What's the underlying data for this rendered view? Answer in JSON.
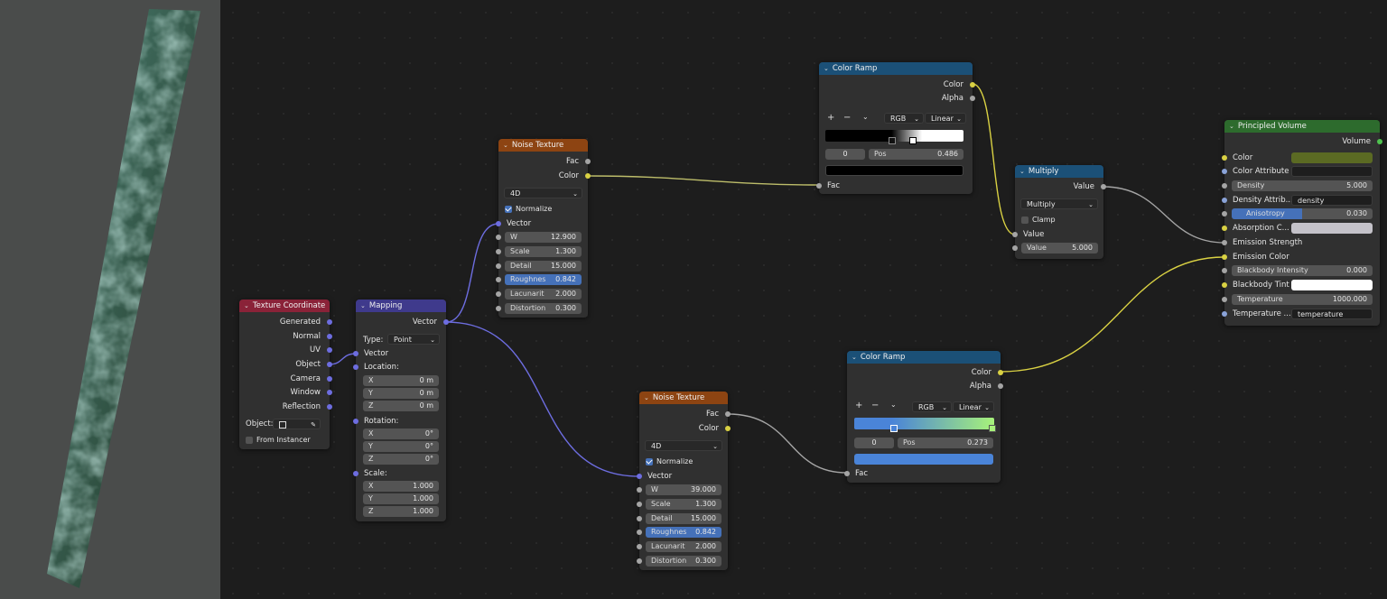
{
  "nodes": {
    "texture_coordinate": {
      "title": "Texture Coordinate",
      "outputs": [
        "Generated",
        "Normal",
        "UV",
        "Object",
        "Camera",
        "Window",
        "Reflection"
      ],
      "object_label": "Object:",
      "from_instancer": "From Instancer"
    },
    "mapping": {
      "title": "Mapping",
      "output": "Vector",
      "type_label": "Type:",
      "type_value": "Point",
      "input_vector": "Vector",
      "location_label": "Location:",
      "location": [
        {
          "axis": "X",
          "value": "0 m"
        },
        {
          "axis": "Y",
          "value": "0 m"
        },
        {
          "axis": "Z",
          "value": "0 m"
        }
      ],
      "rotation_label": "Rotation:",
      "rotation": [
        {
          "axis": "X",
          "value": "0°"
        },
        {
          "axis": "Y",
          "value": "0°"
        },
        {
          "axis": "Z",
          "value": "0°"
        }
      ],
      "scale_label": "Scale:",
      "scale": [
        {
          "axis": "X",
          "value": "1.000"
        },
        {
          "axis": "Y",
          "value": "1.000"
        },
        {
          "axis": "Z",
          "value": "1.000"
        }
      ]
    },
    "noise_texture_1": {
      "title": "Noise Texture",
      "out_fac": "Fac",
      "out_color": "Color",
      "dimensions": "4D",
      "normalize": "Normalize",
      "input_vector": "Vector",
      "fields": [
        {
          "label": "W",
          "value": "12.900"
        },
        {
          "label": "Scale",
          "value": "1.300"
        },
        {
          "label": "Detail",
          "value": "15.000"
        },
        {
          "label": "Roughnes",
          "value": "0.842"
        },
        {
          "label": "Lacunarit",
          "value": "2.000"
        },
        {
          "label": "Distortion",
          "value": "0.300"
        }
      ]
    },
    "noise_texture_2": {
      "title": "Noise Texture",
      "out_fac": "Fac",
      "out_color": "Color",
      "dimensions": "4D",
      "normalize": "Normalize",
      "input_vector": "Vector",
      "fields": [
        {
          "label": "W",
          "value": "39.000"
        },
        {
          "label": "Scale",
          "value": "1.300"
        },
        {
          "label": "Detail",
          "value": "15.000"
        },
        {
          "label": "Roughnes",
          "value": "0.842"
        },
        {
          "label": "Lacunarit",
          "value": "2.000"
        },
        {
          "label": "Distortion",
          "value": "0.300"
        }
      ]
    },
    "color_ramp_1": {
      "title": "Color Ramp",
      "out_color": "Color",
      "out_alpha": "Alpha",
      "mode": "RGB",
      "interpolation": "Linear",
      "index": "0",
      "pos_label": "Pos",
      "pos_value": "0.486",
      "input_fac": "Fac"
    },
    "color_ramp_2": {
      "title": "Color Ramp",
      "out_color": "Color",
      "out_alpha": "Alpha",
      "mode": "RGB",
      "interpolation": "Linear",
      "index": "0",
      "pos_label": "Pos",
      "pos_value": "0.273",
      "input_fac": "Fac"
    },
    "multiply": {
      "title": "Multiply",
      "out_value": "Value",
      "operation": "Multiply",
      "clamp": "Clamp",
      "in_value": "Value",
      "value_label": "Value",
      "value": "5.000"
    },
    "principled_volume": {
      "title": "Principled Volume",
      "out_volume": "Volume",
      "color": "Color",
      "color_attribute": "Color Attribute",
      "density_label": "Density",
      "density_value": "5.000",
      "density_attribute_label": "Density Attrib...",
      "density_attribute_value": "density",
      "anisotropy_label": "Anisotropy",
      "anisotropy_value": "0.030",
      "absorption_color": "Absorption C...",
      "emission_strength": "Emission Strength",
      "emission_color": "Emission Color",
      "blackbody_intensity_label": "Blackbody Intensity",
      "blackbody_intensity_value": "0.000",
      "blackbody_tint": "Blackbody Tint",
      "temperature_label": "Temperature",
      "temperature_value": "1000.000",
      "temperature_attribute_label": "Temperature ...",
      "temperature_attribute_value": "temperature"
    }
  },
  "colors": {
    "texture_header": "#8d4412",
    "converter_header": "#1b5077",
    "input_header": "#8a2238",
    "vector_header": "#3f3a8c",
    "shader_header": "#2d6b2d",
    "volume_color": "#5b6a23",
    "absorption_color": "#c4c2c9",
    "blackbody_tint": "#ffffff"
  },
  "anisotropy_fraction": 0.5,
  "roughness_fraction": 0.842
}
